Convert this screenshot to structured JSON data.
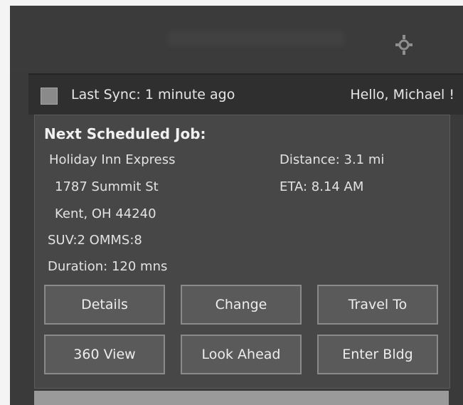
{
  "status_bar": {
    "sync_text": "Last Sync: 1 minute ago",
    "greeting": "Hello, Michael !"
  },
  "job": {
    "heading": "Next Scheduled Job:",
    "location_name": "Holiday Inn Express",
    "street": "1787 Summit St",
    "city_state_zip": "Kent, OH 44240",
    "counts": "SUV:2 OMMS:8",
    "duration": "Duration: 120 mns",
    "distance": "Distance: 3.1 mi",
    "eta": "ETA: 8.14 AM"
  },
  "buttons": {
    "details": "Details",
    "change": "Change",
    "travel_to": "Travel To",
    "view_360": "360 View",
    "look_ahead": "Look Ahead",
    "enter_bldg": "Enter Bldg"
  },
  "icons": {
    "settings": "gear-icon",
    "sync": "sync-status-icon"
  }
}
